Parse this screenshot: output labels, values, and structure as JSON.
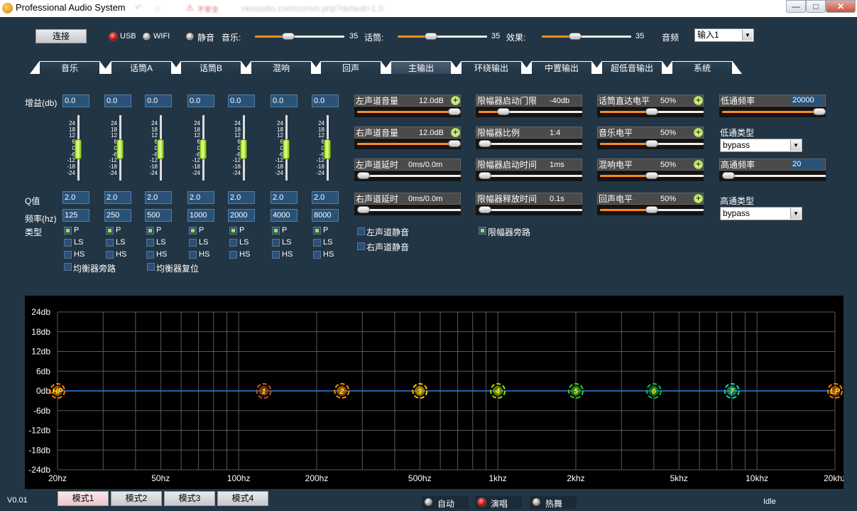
{
  "window": {
    "title": "Professional Audio System",
    "blurred_address": "nksaudio.com/comm.php?default=1.0",
    "blurred_label": "不安全",
    "controls": [
      "—",
      "□",
      "✕"
    ]
  },
  "toolbar": {
    "connect_label": "连接",
    "usb_label": "USB",
    "wifi_label": "WIFI",
    "mute_label": "静音",
    "music_label": "音乐:",
    "music_value": "35",
    "music_level": 0.35,
    "mic_label": "话筒:",
    "mic_value": "35",
    "mic_level": 0.35,
    "effect_label": "效果:",
    "effect_value": "35",
    "effect_level": 0.35,
    "source_label": "音频",
    "source_selected": "输入1"
  },
  "tabs": [
    {
      "label": "音乐",
      "active": false
    },
    {
      "label": "话筒A",
      "active": false
    },
    {
      "label": "话筒B",
      "active": false
    },
    {
      "label": "混响",
      "active": false
    },
    {
      "label": "回声",
      "active": false
    },
    {
      "label": "主输出",
      "active": true
    },
    {
      "label": "环绕输出",
      "active": false
    },
    {
      "label": "中置输出",
      "active": false
    },
    {
      "label": "超低音输出",
      "active": false
    },
    {
      "label": "系统",
      "active": false
    }
  ],
  "eq": {
    "gain_label": "增益(db)",
    "q_label": "Q值",
    "freq_label": "频率(hz)",
    "type_label": "类型",
    "scale": [
      "24",
      "18",
      "12",
      "6",
      "0",
      "-6",
      "-12",
      "-18",
      "-24"
    ],
    "bands": [
      {
        "gain": "0.0",
        "q": "2.0",
        "freq": "125",
        "type": "P"
      },
      {
        "gain": "0.0",
        "q": "2.0",
        "freq": "250",
        "type": "P"
      },
      {
        "gain": "0.0",
        "q": "2.0",
        "freq": "500",
        "type": "P"
      },
      {
        "gain": "0.0",
        "q": "2.0",
        "freq": "1000",
        "type": "P"
      },
      {
        "gain": "0.0",
        "q": "2.0",
        "freq": "2000",
        "type": "P"
      },
      {
        "gain": "0.0",
        "q": "2.0",
        "freq": "4000",
        "type": "P"
      },
      {
        "gain": "0.0",
        "q": "2.0",
        "freq": "8000",
        "type": "P"
      }
    ],
    "type_p": "P",
    "type_ls": "LS",
    "type_hs": "HS",
    "bypass_label": "均衡器旁路",
    "reset_label": "均衡器复位"
  },
  "output": {
    "left_volume": {
      "label": "左声道音量",
      "value": "12.0dB",
      "level": 1.0
    },
    "right_volume": {
      "label": "右声道音量",
      "value": "12.0dB",
      "level": 1.0
    },
    "left_delay": {
      "label": "左声道延时",
      "value": "0ms/0.0m",
      "level": 0.0
    },
    "right_delay": {
      "label": "右声道延时",
      "value": "0ms/0.0m",
      "level": 0.0
    },
    "left_mute_label": "左声道静音",
    "right_mute_label": "右声道静音"
  },
  "limiter": {
    "threshold": {
      "label": "限幅器启动门限",
      "value": "-40db",
      "level": 0.2
    },
    "ratio": {
      "label": "限幅器比例",
      "value": "1:4",
      "level": 0.0
    },
    "attack": {
      "label": "限幅器启动时间",
      "value": "1ms",
      "level": 0.0
    },
    "release": {
      "label": "限幅器释放时间",
      "value": "0.1s",
      "level": 0.0
    },
    "bypass_label": "限幅器旁路",
    "bypass_checked": true
  },
  "mix": {
    "mic_direct": {
      "label": "话筒直达电平",
      "value": "50%",
      "level": 0.5
    },
    "music": {
      "label": "音乐电平",
      "value": "50%",
      "level": 0.5
    },
    "reverb": {
      "label": "混响电平",
      "value": "50%",
      "level": 0.5
    },
    "echo": {
      "label": "回声电平",
      "value": "50%",
      "level": 0.5
    }
  },
  "filters": {
    "lowpass_freq_label": "低通频率",
    "lowpass_freq_value": "20000",
    "lowpass_level": 1.0,
    "lowpass_type_label": "低通类型",
    "lowpass_type_value": "bypass",
    "highpass_freq_label": "高通频率",
    "highpass_freq_value": "20",
    "highpass_level": 0.0,
    "highpass_type_label": "高通类型",
    "highpass_type_value": "bypass"
  },
  "graph": {
    "y_labels": [
      "24db",
      "18db",
      "12db",
      "6db",
      "0db",
      "-6db",
      "-12db",
      "-18db",
      "-24db"
    ],
    "x_labels": [
      "20hz",
      "50hz",
      "100hz",
      "200hz",
      "500hz",
      "1khz",
      "2khz",
      "5khz",
      "10khz",
      "20khz"
    ],
    "x_label_freqs": [
      20,
      50,
      100,
      200,
      500,
      1000,
      2000,
      5000,
      10000,
      20000
    ],
    "ymin": -24,
    "ymax": 24,
    "xmin": 20,
    "xmax": 20000,
    "markers": [
      {
        "label": "HP",
        "freq": 20,
        "gain": 0,
        "color": "#ff7a00"
      },
      {
        "label": "1",
        "freq": 125,
        "gain": 0,
        "color": "#c9541f"
      },
      {
        "label": "2",
        "freq": 250,
        "gain": 0,
        "color": "#ff8c00"
      },
      {
        "label": "3",
        "freq": 500,
        "gain": 0,
        "color": "#ffc400"
      },
      {
        "label": "4",
        "freq": 1000,
        "gain": 0,
        "color": "#9fdc00"
      },
      {
        "label": "5",
        "freq": 2000,
        "gain": 0,
        "color": "#2ed12a"
      },
      {
        "label": "6",
        "freq": 4000,
        "gain": 0,
        "color": "#10b94a"
      },
      {
        "label": "7",
        "freq": 8000,
        "gain": 0,
        "color": "#14d6a6"
      },
      {
        "label": "LP",
        "freq": 20000,
        "gain": 0,
        "color": "#ff7a00"
      }
    ]
  },
  "bottom": {
    "version": "V0.01",
    "modes": [
      "模式1",
      "模式2",
      "模式3",
      "模式4"
    ],
    "active_mode": 0,
    "preset_auto": "自动",
    "preset_sing": "演唱",
    "preset_dance": "热舞",
    "status": "Idle"
  }
}
